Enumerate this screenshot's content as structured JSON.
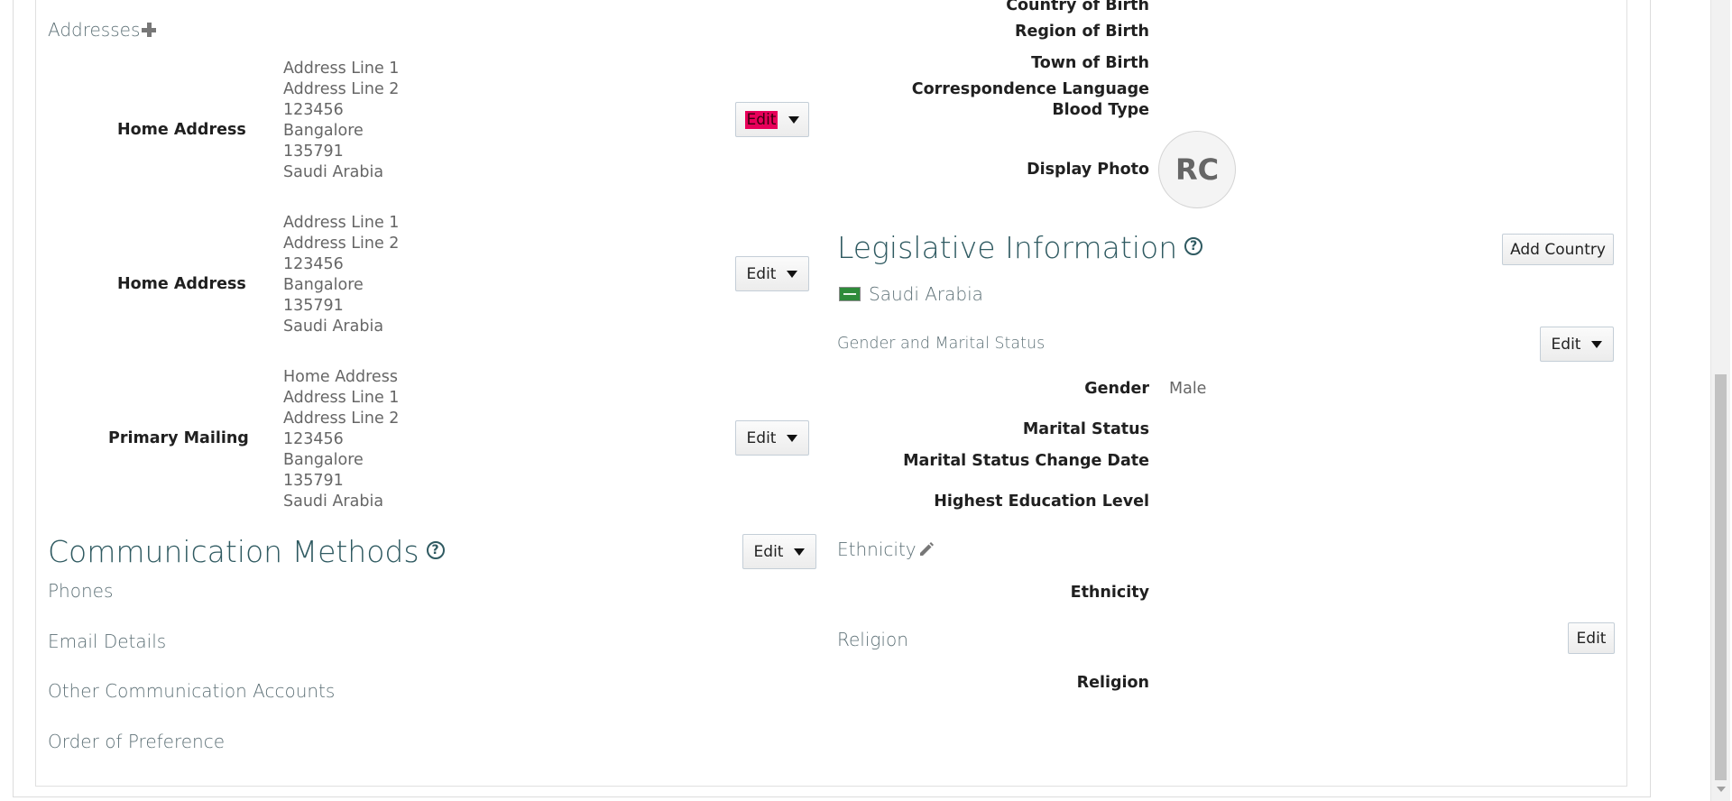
{
  "addresses": {
    "heading": "Addresses",
    "items": [
      {
        "label": "Home Address",
        "lines": [
          "Address Line 1",
          "Address Line 2",
          "123456",
          "Bangalore",
          "135791",
          "Saudi Arabia"
        ],
        "edit": "Edit"
      },
      {
        "label": "Home Address",
        "lines": [
          "Address Line 1",
          "Address Line 2",
          "123456",
          "Bangalore",
          "135791",
          "Saudi Arabia"
        ],
        "edit": "Edit"
      },
      {
        "label": "Primary Mailing",
        "lines": [
          "Home Address",
          "Address Line 1",
          "Address Line 2",
          "123456",
          "Bangalore",
          "135791",
          "Saudi Arabia"
        ],
        "edit": "Edit"
      }
    ]
  },
  "communication": {
    "title": "Communication Methods",
    "help": "?",
    "edit": "Edit",
    "phones": "Phones",
    "email": "Email Details",
    "other": "Other Communication Accounts",
    "order": "Order of Preference"
  },
  "personal": {
    "country_of_birth": "Country of Birth",
    "region_of_birth": "Region of Birth",
    "town_of_birth": "Town of Birth",
    "correspondence_language": "Correspondence Language",
    "blood_type": "Blood Type",
    "display_photo": "Display Photo",
    "avatar_initials": "RC"
  },
  "legislative": {
    "title": "Legislative Information",
    "help": "?",
    "add_country": "Add Country",
    "country": "Saudi Arabia",
    "gender_marital_heading": "Gender and Marital Status",
    "edit": "Edit",
    "gender_label": "Gender",
    "gender_value": "Male",
    "marital_status_label": "Marital Status",
    "marital_change_label": "Marital Status Change Date",
    "education_label": "Highest Education Level",
    "ethnicity_heading": "Ethnicity",
    "ethnicity_label": "Ethnicity",
    "religion_heading": "Religion",
    "religion_edit": "Edit",
    "religion_label": "Religion"
  },
  "colors": {
    "title": "#2f5a61",
    "highlight": "#e8005a",
    "flag": "#2e8b3a"
  }
}
